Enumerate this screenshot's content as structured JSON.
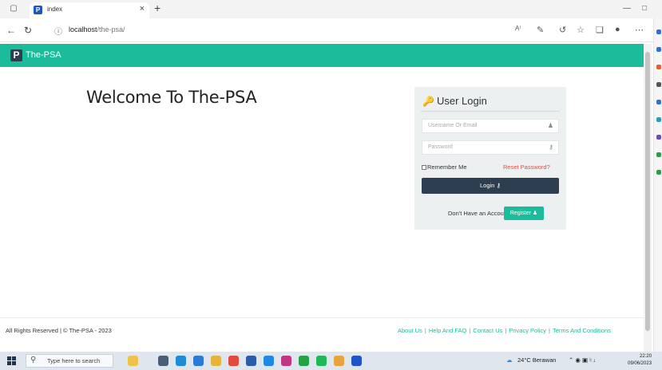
{
  "browser": {
    "tab_title": "index",
    "tab_favicon": "P",
    "url_host": "localhost",
    "url_path": "/the-psa/"
  },
  "site": {
    "brand_logo": "P",
    "brand_name": "The-PSA",
    "welcome": "Welcome To The-PSA"
  },
  "login": {
    "title": "User Login",
    "username_placeholder": "Username Or Email",
    "password_placeholder": "Password",
    "remember_label": "Remember Me",
    "reset_label": "Reset Password?",
    "login_label": "Login",
    "no_account_text": "Don't Have an Account?",
    "register_label": "Register"
  },
  "footer": {
    "copyright": "All Rights Reserved | © The-PSA - 2023",
    "links": [
      "About Us",
      "Help And FAQ",
      "Contact Us",
      "Privacy Policy",
      "Terms And Conditions"
    ]
  },
  "taskbar": {
    "search_placeholder": "Type here to search",
    "weather": "24°C  Berawan",
    "time": "22:20",
    "date": "09/06/2023"
  },
  "colors": {
    "brand_teal": "#1abc9c",
    "dark_navy": "#2c3e50",
    "panel_bg": "#ecf0f1",
    "reset_red": "#e74c3c"
  }
}
